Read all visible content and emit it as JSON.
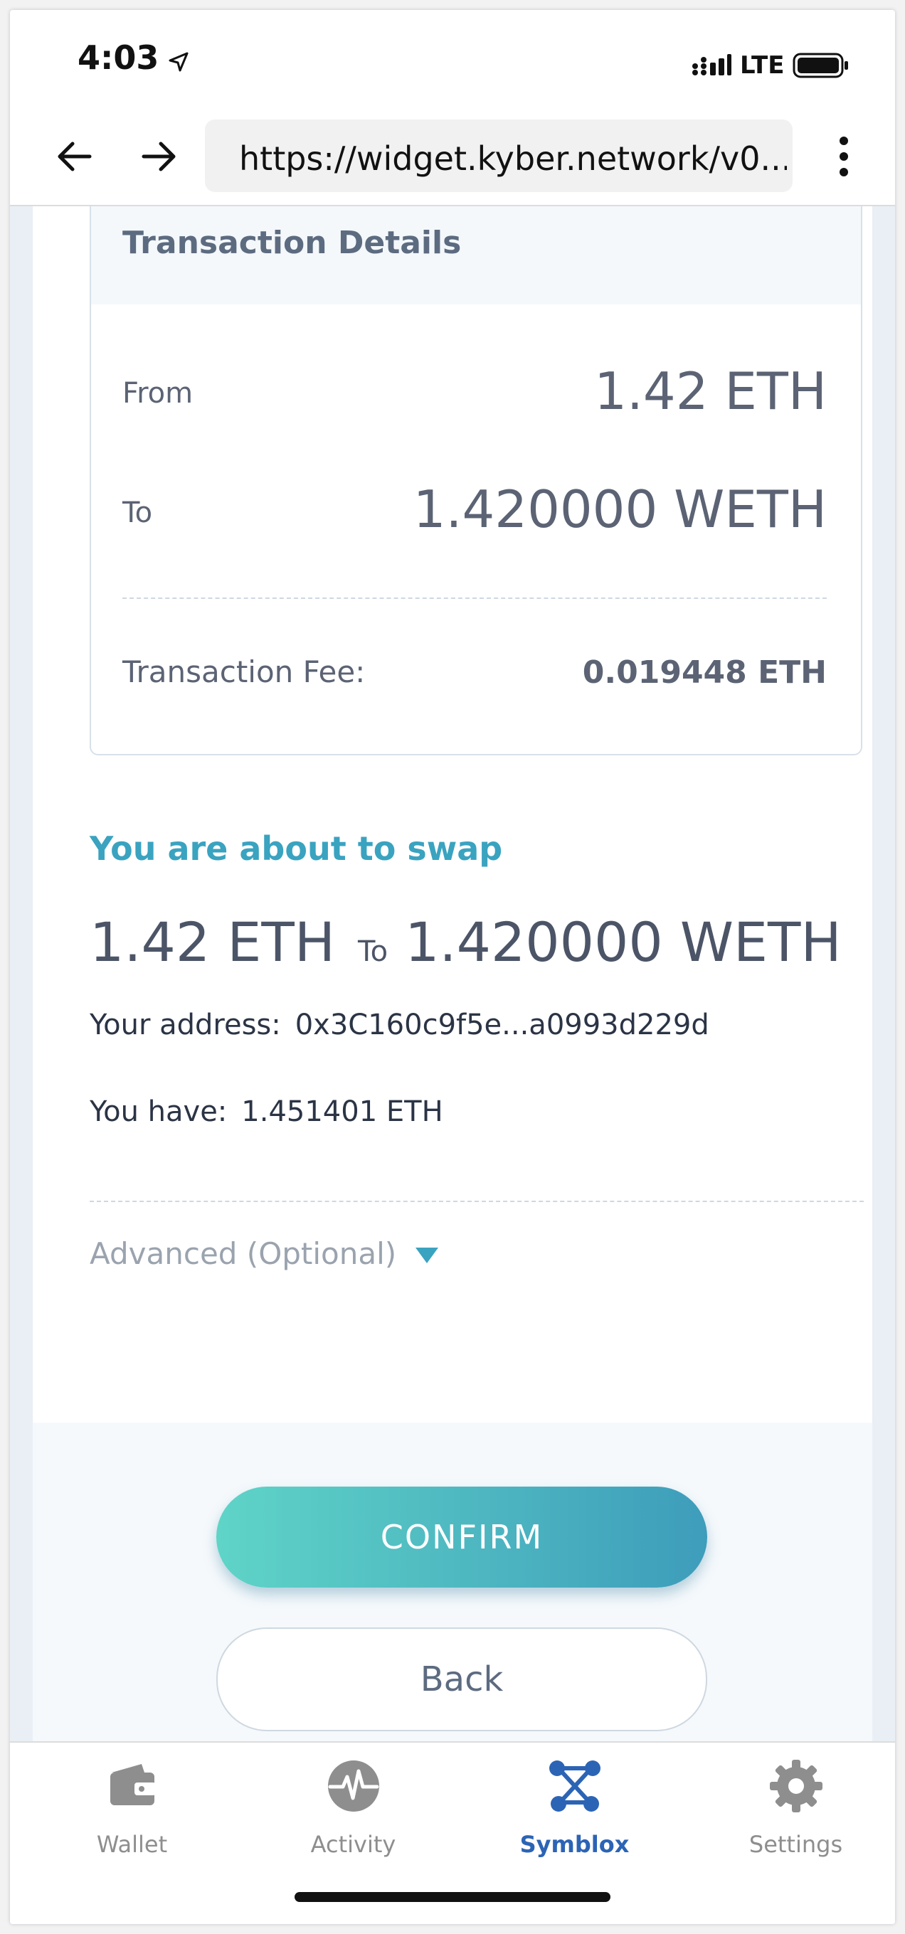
{
  "status_bar": {
    "time": "4:03",
    "network": "LTE"
  },
  "browser": {
    "url": "https://widget.kyber.network/v0...."
  },
  "transaction_details": {
    "title": "Transaction Details",
    "from_label": "From",
    "from_value": "1.42 ETH",
    "to_label": "To",
    "to_value": "1.420000 WETH",
    "fee_label": "Transaction Fee:",
    "fee_value": "0.019448 ETH"
  },
  "swap": {
    "title": "You are about to swap",
    "from_amount": "1.42 ETH",
    "to_word": "To",
    "to_amount": "1.420000 WETH",
    "address_label": "Your address:",
    "address_value": "0x3C160c9f5e...a0993d229d",
    "balance_label": "You have:",
    "balance_value": "1.451401 ETH",
    "advanced_label": "Advanced (Optional)"
  },
  "actions": {
    "confirm_label": "CONFIRM",
    "back_label": "Back"
  },
  "tab_bar": {
    "active": "Symblox",
    "items": [
      {
        "label": "Wallet",
        "icon": "wallet-icon"
      },
      {
        "label": "Activity",
        "icon": "activity-icon"
      },
      {
        "label": "Symblox",
        "icon": "symblox-icon"
      },
      {
        "label": "Settings",
        "icon": "gear-icon"
      }
    ]
  },
  "colors": {
    "accent": "#3aa3c0",
    "confirm_gradient_start": "#5fd4c7",
    "confirm_gradient_end": "#3e9dbb",
    "active_tab": "#2c64b5",
    "text_primary": "#4c5567"
  }
}
